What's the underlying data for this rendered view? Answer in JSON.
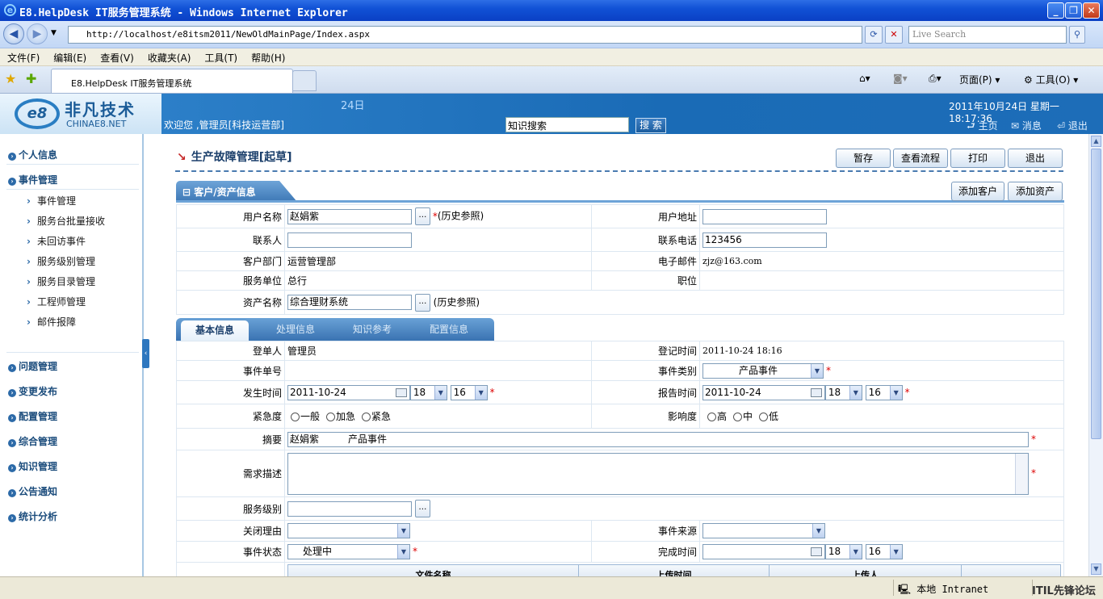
{
  "window": {
    "title": "E8.HelpDesk IT服务管理系统 - Windows Internet Explorer"
  },
  "browser": {
    "url": "http://localhost/e8itsm2011/NewOldMainPage/Index.aspx",
    "search_placeholder": "Live Search",
    "menu": [
      "文件(F)",
      "编辑(E)",
      "查看(V)",
      "收藏夹(A)",
      "工具(T)",
      "帮助(H)"
    ],
    "tab_title": "E8.HelpDesk IT服务管理系统",
    "toolbar": {
      "page": "页面(P)",
      "tools": "工具(O)"
    }
  },
  "header": {
    "logo_cn": "非凡技术",
    "logo_en": "CHINAE8.NET",
    "day": "24日",
    "welcome": "欢迎您 ,管理员[科技运营部]",
    "knowledge_search_value": "知识搜索",
    "search_button": "搜 索",
    "datetime": "2011年10月24日 星期一 18:17:36",
    "links": {
      "home": "主页",
      "messages": "消息",
      "logout": "退出"
    }
  },
  "sidebar": {
    "groups_top": [
      "个人信息",
      "事件管理"
    ],
    "event_items": [
      "事件管理",
      "服务台批量接收",
      "未回访事件",
      "服务级别管理",
      "服务目录管理",
      "工程师管理",
      "邮件报障"
    ],
    "groups_bottom": [
      "问题管理",
      "变更发布",
      "配置管理",
      "综合管理",
      "知识管理",
      "公告通知",
      "统计分析"
    ]
  },
  "page": {
    "title": "生产故障管理[起草]",
    "buttons": {
      "save": "暂存",
      "view_flow": "查看流程",
      "print": "打印",
      "exit": "退出"
    },
    "customer_section": "客户/资产信息",
    "add_customer": "添加客户",
    "add_asset": "添加资产",
    "history_ref": "(历史参照)",
    "customer": {
      "user_name_label": "用户名称",
      "user_name": "赵娟紫",
      "user_addr_label": "用户地址",
      "user_addr": "",
      "contact_label": "联系人",
      "contact": "",
      "phone_label": "联系电话",
      "phone": "123456",
      "dept_label": "客户部门",
      "dept": "运营管理部",
      "email_label": "电子邮件",
      "email": "zjz@163.com",
      "unit_label": "服务单位",
      "unit": "总行",
      "position_label": "职位",
      "position": "",
      "asset_label": "资产名称",
      "asset": "综合理财系统"
    },
    "tabs": [
      "基本信息",
      "处理信息",
      "知识参考",
      "配置信息"
    ],
    "basic": {
      "registrant_label": "登单人",
      "registrant": "管理员",
      "reg_time_label": "登记时间",
      "reg_time": "2011-10-24 18:16",
      "event_no_label": "事件单号",
      "event_no": "",
      "event_type_label": "事件类别",
      "event_type": "产品事件",
      "occur_label": "发生时间",
      "occur_date": "2011-10-24",
      "occur_hour": "18",
      "occur_min": "16",
      "report_label": "报告时间",
      "report_date": "2011-10-24",
      "report_hour": "18",
      "report_min": "16",
      "urgency_label": "紧急度",
      "urgency_opts": [
        "一般",
        "加急",
        "紧急"
      ],
      "impact_label": "影响度",
      "impact_opts": [
        "高",
        "中",
        "低"
      ],
      "summary_label": "摘要",
      "summary": "赵娟紫　　　产品事件",
      "desc_label": "需求描述",
      "desc": "",
      "sla_label": "服务级别",
      "sla": "",
      "close_reason_label": "关闭理由",
      "close_reason": "",
      "source_label": "事件来源",
      "source": "",
      "status_label": "事件状态",
      "status": "处理中",
      "finish_label": "完成时间",
      "finish_date": "",
      "finish_hour": "18",
      "finish_min": "16"
    },
    "attach_headers": [
      "文件名称",
      "上传时间",
      "上传人"
    ]
  },
  "statusbar": {
    "zone": "本地 Intranet",
    "watermark": "ITIL先锋论坛"
  }
}
